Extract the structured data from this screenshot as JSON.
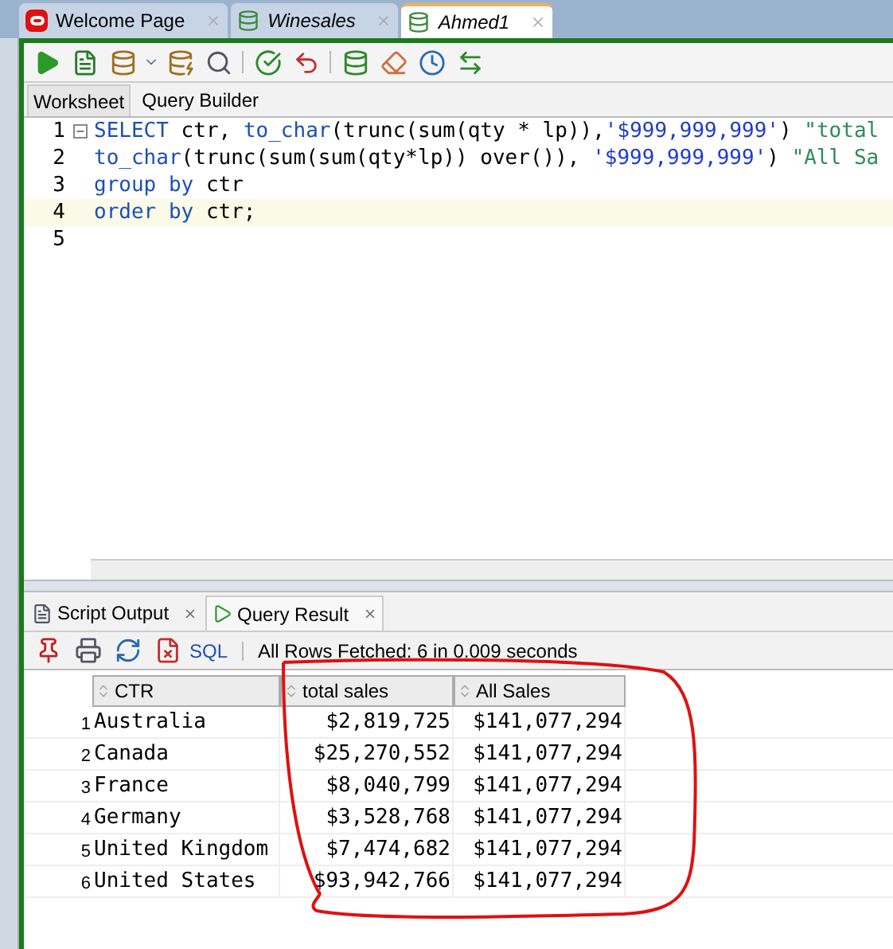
{
  "doc_tabs": [
    {
      "label": "Welcome Page",
      "kind": "oracle",
      "selected": false
    },
    {
      "label": "Winesales",
      "kind": "sql",
      "selected": false
    },
    {
      "label": "Ahmed1",
      "kind": "sql",
      "selected": true
    }
  ],
  "editor_tabs": [
    {
      "label": "Worksheet",
      "selected": true
    },
    {
      "label": "Query Builder",
      "selected": false
    }
  ],
  "editor_lines": [
    {
      "number": "1",
      "fold": true,
      "current": false,
      "tokens": [
        {
          "kind": "keyword",
          "text": "SELECT"
        },
        {
          "kind": "plain",
          "text": " ctr, "
        },
        {
          "kind": "keyword",
          "text": "to_char"
        },
        {
          "kind": "plain",
          "text": "(trunc(sum(qty * lp)),"
        },
        {
          "kind": "string",
          "text": "'$999,999,999'"
        },
        {
          "kind": "plain",
          "text": ") "
        },
        {
          "kind": "alias",
          "text": "\"total"
        }
      ]
    },
    {
      "number": "2",
      "fold": false,
      "current": false,
      "tokens": [
        {
          "kind": "keyword",
          "text": "to_char"
        },
        {
          "kind": "plain",
          "text": "(trunc(sum(sum(qty*lp)) over()), "
        },
        {
          "kind": "string",
          "text": "'$999,999,999'"
        },
        {
          "kind": "plain",
          "text": ") "
        },
        {
          "kind": "alias",
          "text": "\"All Sa"
        }
      ]
    },
    {
      "number": "3",
      "fold": false,
      "current": false,
      "tokens": [
        {
          "kind": "keyword",
          "text": "group by"
        },
        {
          "kind": "plain",
          "text": " ctr"
        }
      ]
    },
    {
      "number": "4",
      "fold": false,
      "current": true,
      "tokens": [
        {
          "kind": "keyword",
          "text": "order by"
        },
        {
          "kind": "plain",
          "text": " ctr;"
        }
      ]
    },
    {
      "number": "5",
      "fold": false,
      "current": false
    }
  ],
  "result_tabs": [
    {
      "label": "Script Output",
      "kind": "script",
      "selected": false
    },
    {
      "label": "Query Result",
      "kind": "query",
      "selected": true
    }
  ],
  "result_toolbar": {
    "sql_link": "SQL",
    "status": "All Rows Fetched: 6 in 0.009 seconds"
  },
  "table": {
    "columns": [
      "CTR",
      "total sales",
      "All Sales"
    ],
    "rows": [
      {
        "n": "1",
        "cells": [
          "Australia",
          "$2,819,725",
          "$141,077,294"
        ]
      },
      {
        "n": "2",
        "cells": [
          "Canada",
          "$25,270,552",
          "$141,077,294"
        ]
      },
      {
        "n": "3",
        "cells": [
          "France",
          "$8,040,799",
          "$141,077,294"
        ]
      },
      {
        "n": "4",
        "cells": [
          "Germany",
          "$3,528,768",
          "$141,077,294"
        ]
      },
      {
        "n": "5",
        "cells": [
          "United Kingdom",
          "$7,474,682",
          "$141,077,294"
        ]
      },
      {
        "n": "6",
        "cells": [
          "United States",
          "$93,942,766",
          "$141,077,294"
        ]
      }
    ]
  }
}
